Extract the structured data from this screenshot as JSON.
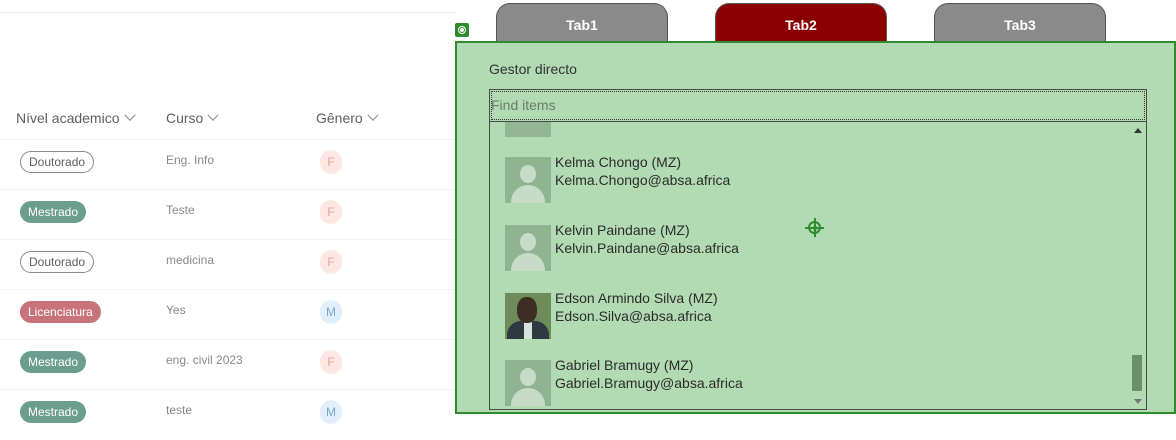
{
  "list": {
    "columns": {
      "nivel": "Nível academico",
      "curso": "Curso",
      "genero": "Gênero"
    },
    "rows": [
      {
        "nivel": "Doutorado",
        "nivel_style": "outline",
        "curso": "Eng. Info",
        "genero": "F"
      },
      {
        "nivel": "Mestrado",
        "nivel_style": "green",
        "curso": "Teste",
        "genero": "F"
      },
      {
        "nivel": "Doutorado",
        "nivel_style": "outline",
        "curso": "medicina",
        "genero": "F"
      },
      {
        "nivel": "Licenciatura",
        "nivel_style": "red",
        "curso": "Yes",
        "genero": "M"
      },
      {
        "nivel": "Mestrado",
        "nivel_style": "green",
        "curso": "eng. civil 2023",
        "genero": "F"
      },
      {
        "nivel": "Mestrado",
        "nivel_style": "green",
        "curso": "teste",
        "genero": "M"
      }
    ]
  },
  "tabs": [
    {
      "label": "Tab1",
      "active": false
    },
    {
      "label": "Tab2",
      "active": true
    },
    {
      "label": "Tab3",
      "active": false
    }
  ],
  "panel": {
    "label": "Gestor directo",
    "search_placeholder": "Find items",
    "people": [
      {
        "name": "Kelma Chongo (MZ)",
        "email": "Kelma.Chongo@absa.africa",
        "avatar": "placeholder"
      },
      {
        "name": "Kelvin Paindane (MZ)",
        "email": "Kelvin.Paindane@absa.africa",
        "avatar": "placeholder"
      },
      {
        "name": "Edson Armindo Silva (MZ)",
        "email": "Edson.Silva@absa.africa",
        "avatar": "photo"
      },
      {
        "name": "Gabriel Bramugy (MZ)",
        "email": "Gabriel.Bramugy@absa.africa",
        "avatar": "placeholder"
      }
    ]
  },
  "colors": {
    "panel_bg": "#b3dbb3",
    "panel_border": "#2e8b2e",
    "tab_active": "#8b0000",
    "tab_inactive": "#8a8a8a",
    "pill_green": "#6b9e8f",
    "pill_red": "#c8737a"
  },
  "icons": [
    "chevron-down-icon",
    "person-placeholder-icon",
    "target-icon",
    "selection-handle-icon",
    "scroll-up-icon",
    "scroll-down-icon"
  ]
}
